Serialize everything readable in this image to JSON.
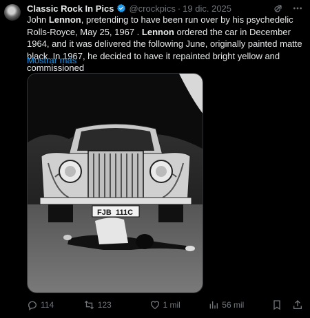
{
  "tweet": {
    "author_name": "Classic Rock In Pics",
    "handle": "@crockpics",
    "separator": "·",
    "date": "19 dic. 2025",
    "text_parts": [
      "John ",
      "Lennon",
      ", pretending to have been run over by his psychedelic Rolls-Royce, May 25, 1967 . ",
      "Lennon",
      " ordered the  car in December 1964, and it was delivered the following June, originally painted matte black. In 1967, he decided to have it repainted bright yellow and commissioned"
    ],
    "show_more": "Mostrar más",
    "image": {
      "license_plate": "FJB 111C",
      "plate_prefix": "FJB",
      "plate_suffix": "111C"
    }
  },
  "actions": {
    "replies": "114",
    "retweets": "123",
    "likes": "1 mil",
    "views": "56 mil"
  },
  "icons": {
    "verified": "verified-badge-icon",
    "grok": "grok-icon",
    "more": "more-options-icon",
    "reply": "reply-icon",
    "retweet": "retweet-icon",
    "like": "like-icon",
    "views": "views-icon",
    "bookmark": "bookmark-icon",
    "share": "share-icon"
  },
  "colors": {
    "background": "#000000",
    "text": "#e7e9ea",
    "secondary": "#71767b",
    "link": "#1d9bf0"
  }
}
